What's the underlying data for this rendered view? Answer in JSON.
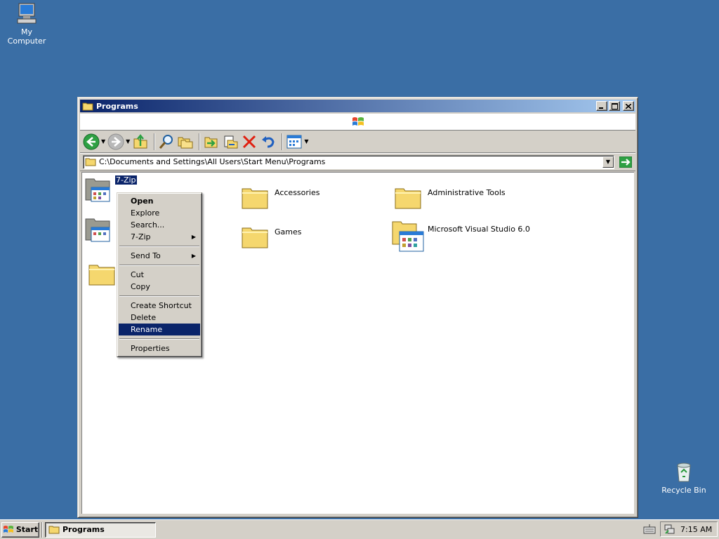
{
  "desktop": {
    "icons": [
      {
        "label": "My Computer"
      },
      {
        "label": "Recycle Bin"
      }
    ]
  },
  "window": {
    "title": "Programs",
    "controls": {
      "minimize": "minimize-icon",
      "maximize": "maximize-icon",
      "close": "close-icon"
    },
    "toolbar": {
      "buttons": [
        "back-icon",
        "forward-icon",
        "up-folder-icon",
        "search-icon",
        "folders-icon",
        "move-to-icon",
        "copy-to-icon",
        "delete-icon",
        "undo-icon",
        "views-icon"
      ]
    },
    "address": {
      "value": "C:\\Documents and Settings\\All Users\\Start Menu\\Programs"
    },
    "items": [
      {
        "label": "7-Zip",
        "selected": true
      },
      {
        "label": "Accessories"
      },
      {
        "label": "Administrative Tools"
      },
      {
        "label": "Games"
      },
      {
        "label": "Microsoft Visual Studio 6.0"
      },
      {
        "label": ""
      },
      {
        "label": ""
      }
    ]
  },
  "context_menu": {
    "items": [
      {
        "label": "Open",
        "bold": true
      },
      {
        "label": "Explore"
      },
      {
        "label": "Search..."
      },
      {
        "label": "7-Zip",
        "submenu": true
      },
      {
        "label": "Send To",
        "submenu": true
      },
      {
        "label": "Cut"
      },
      {
        "label": "Copy"
      },
      {
        "label": "Create Shortcut"
      },
      {
        "label": "Delete"
      },
      {
        "label": "Rename",
        "highlighted": true
      },
      {
        "label": "Properties"
      }
    ]
  },
  "taskbar": {
    "start_label": "Start",
    "task_label": "Programs",
    "clock": "7:15 AM"
  },
  "colors": {
    "desktop": "#3a6ea5",
    "title_active": "#0a246a",
    "selection": "#0a246a",
    "face": "#d4d0c8"
  }
}
